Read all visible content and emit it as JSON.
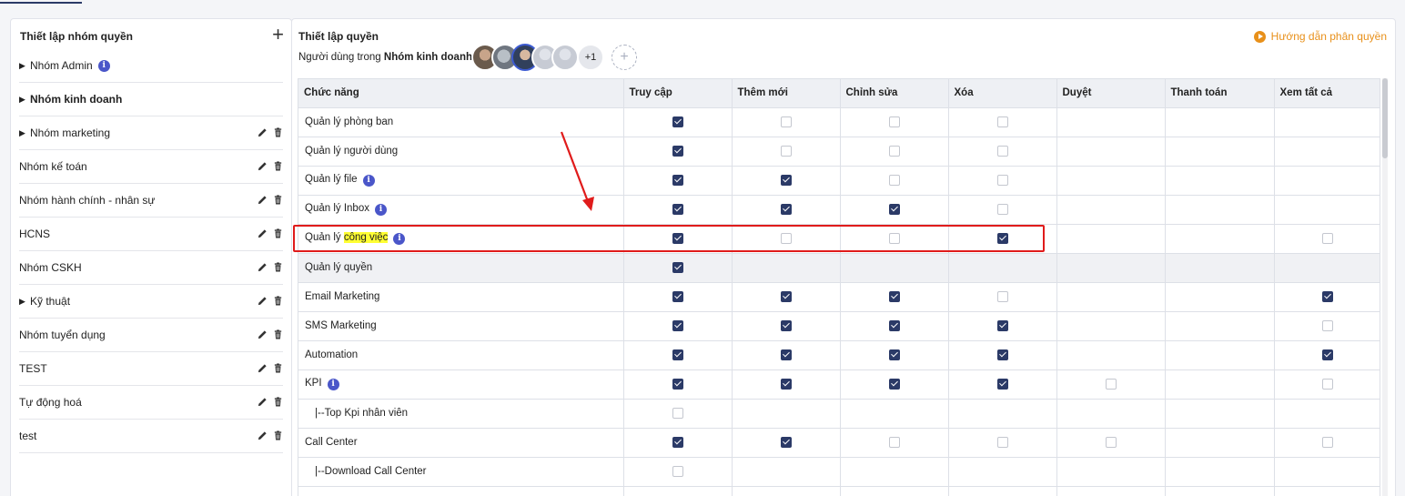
{
  "left": {
    "title": "Thiết lập nhóm quyền",
    "add_icon": "plus-icon",
    "groups": [
      {
        "label": "Nhóm Admin",
        "caret": true,
        "bold": false,
        "info": true,
        "actions": false
      },
      {
        "label": "Nhóm kinh doanh",
        "caret": true,
        "bold": true,
        "info": false,
        "actions": false
      },
      {
        "label": "Nhóm marketing",
        "caret": true,
        "bold": false,
        "info": false,
        "actions": true
      },
      {
        "label": "Nhóm kế toán",
        "caret": false,
        "bold": false,
        "info": false,
        "actions": true
      },
      {
        "label": "Nhóm hành chính - nhân sự",
        "caret": false,
        "bold": false,
        "info": false,
        "actions": true
      },
      {
        "label": "HCNS",
        "caret": false,
        "bold": false,
        "info": false,
        "actions": true
      },
      {
        "label": "Nhóm CSKH",
        "caret": false,
        "bold": false,
        "info": false,
        "actions": true
      },
      {
        "label": "Kỹ thuật",
        "caret": true,
        "bold": false,
        "info": false,
        "actions": true
      },
      {
        "label": "Nhóm tuyển dụng",
        "caret": false,
        "bold": false,
        "info": false,
        "actions": true
      },
      {
        "label": "TEST",
        "caret": false,
        "bold": false,
        "info": false,
        "actions": true
      },
      {
        "label": "Tự động hoá",
        "caret": false,
        "bold": false,
        "info": false,
        "actions": true
      },
      {
        "label": "test",
        "caret": false,
        "bold": false,
        "info": false,
        "actions": true
      }
    ]
  },
  "right": {
    "title": "Thiết lập quyền",
    "users_prefix": "Người dùng trong ",
    "users_group": "Nhóm kinh doanh:",
    "more_users": "+1",
    "add_user": "+",
    "guide_label": "Hướng dẫn phân quyền"
  },
  "table": {
    "columns": [
      "Chức năng",
      "Truy cập",
      "Thêm mới",
      "Chỉnh sửa",
      "Xóa",
      "Duyệt",
      "Thanh toán",
      "Xem tất cả"
    ],
    "rows": [
      {
        "label": "Quản lý phòng ban",
        "info": false,
        "sub": false,
        "shaded": false,
        "cells": [
          1,
          0,
          0,
          0,
          null,
          null,
          null
        ]
      },
      {
        "label": "Quản lý người dùng",
        "info": false,
        "sub": false,
        "shaded": false,
        "cells": [
          1,
          0,
          0,
          0,
          null,
          null,
          null
        ]
      },
      {
        "label": "Quản lý file",
        "info": true,
        "sub": false,
        "shaded": false,
        "cells": [
          1,
          1,
          0,
          0,
          null,
          null,
          null
        ]
      },
      {
        "label": "Quản lý Inbox",
        "info": true,
        "sub": false,
        "shaded": false,
        "cells": [
          1,
          1,
          1,
          0,
          null,
          null,
          null
        ]
      },
      {
        "label_pre": "Quản lý ",
        "label_hl": "công việc",
        "label": "Quản lý công việc",
        "info": true,
        "sub": false,
        "shaded": false,
        "cells": [
          1,
          0,
          0,
          1,
          null,
          null,
          0
        ]
      },
      {
        "label": "Quản lý quyền",
        "info": false,
        "sub": false,
        "shaded": true,
        "cells": [
          1,
          null,
          null,
          null,
          null,
          null,
          null
        ]
      },
      {
        "label": "Email Marketing",
        "info": false,
        "sub": false,
        "shaded": false,
        "cells": [
          1,
          1,
          1,
          0,
          null,
          null,
          1
        ]
      },
      {
        "label": "SMS Marketing",
        "info": false,
        "sub": false,
        "shaded": false,
        "cells": [
          1,
          1,
          1,
          1,
          null,
          null,
          0
        ]
      },
      {
        "label": "Automation",
        "info": false,
        "sub": false,
        "shaded": false,
        "cells": [
          1,
          1,
          1,
          1,
          null,
          null,
          1
        ]
      },
      {
        "label": "KPI",
        "info": true,
        "sub": false,
        "shaded": false,
        "cells": [
          1,
          1,
          1,
          1,
          0,
          null,
          0
        ]
      },
      {
        "label": "|--Top Kpi nhân viên",
        "info": false,
        "sub": true,
        "shaded": false,
        "cells": [
          0,
          null,
          null,
          null,
          null,
          null,
          null
        ]
      },
      {
        "label": "Call Center",
        "info": false,
        "sub": false,
        "shaded": false,
        "cells": [
          1,
          1,
          0,
          0,
          0,
          null,
          0
        ]
      },
      {
        "label": "|--Download Call Center",
        "info": false,
        "sub": true,
        "shaded": false,
        "cells": [
          0,
          null,
          null,
          null,
          null,
          null,
          null
        ]
      },
      {
        "label": "",
        "info": false,
        "sub": false,
        "shaded": false,
        "cells": [
          null,
          null,
          null,
          null,
          null,
          null,
          null
        ]
      }
    ]
  },
  "colors": {
    "checkbox_checked": "#2b3a67",
    "highlight_border": "#e01b1b",
    "highlight_text_bg": "#ffff33",
    "guide_link": "#e8901a",
    "info_icon": "#4a56c9"
  }
}
